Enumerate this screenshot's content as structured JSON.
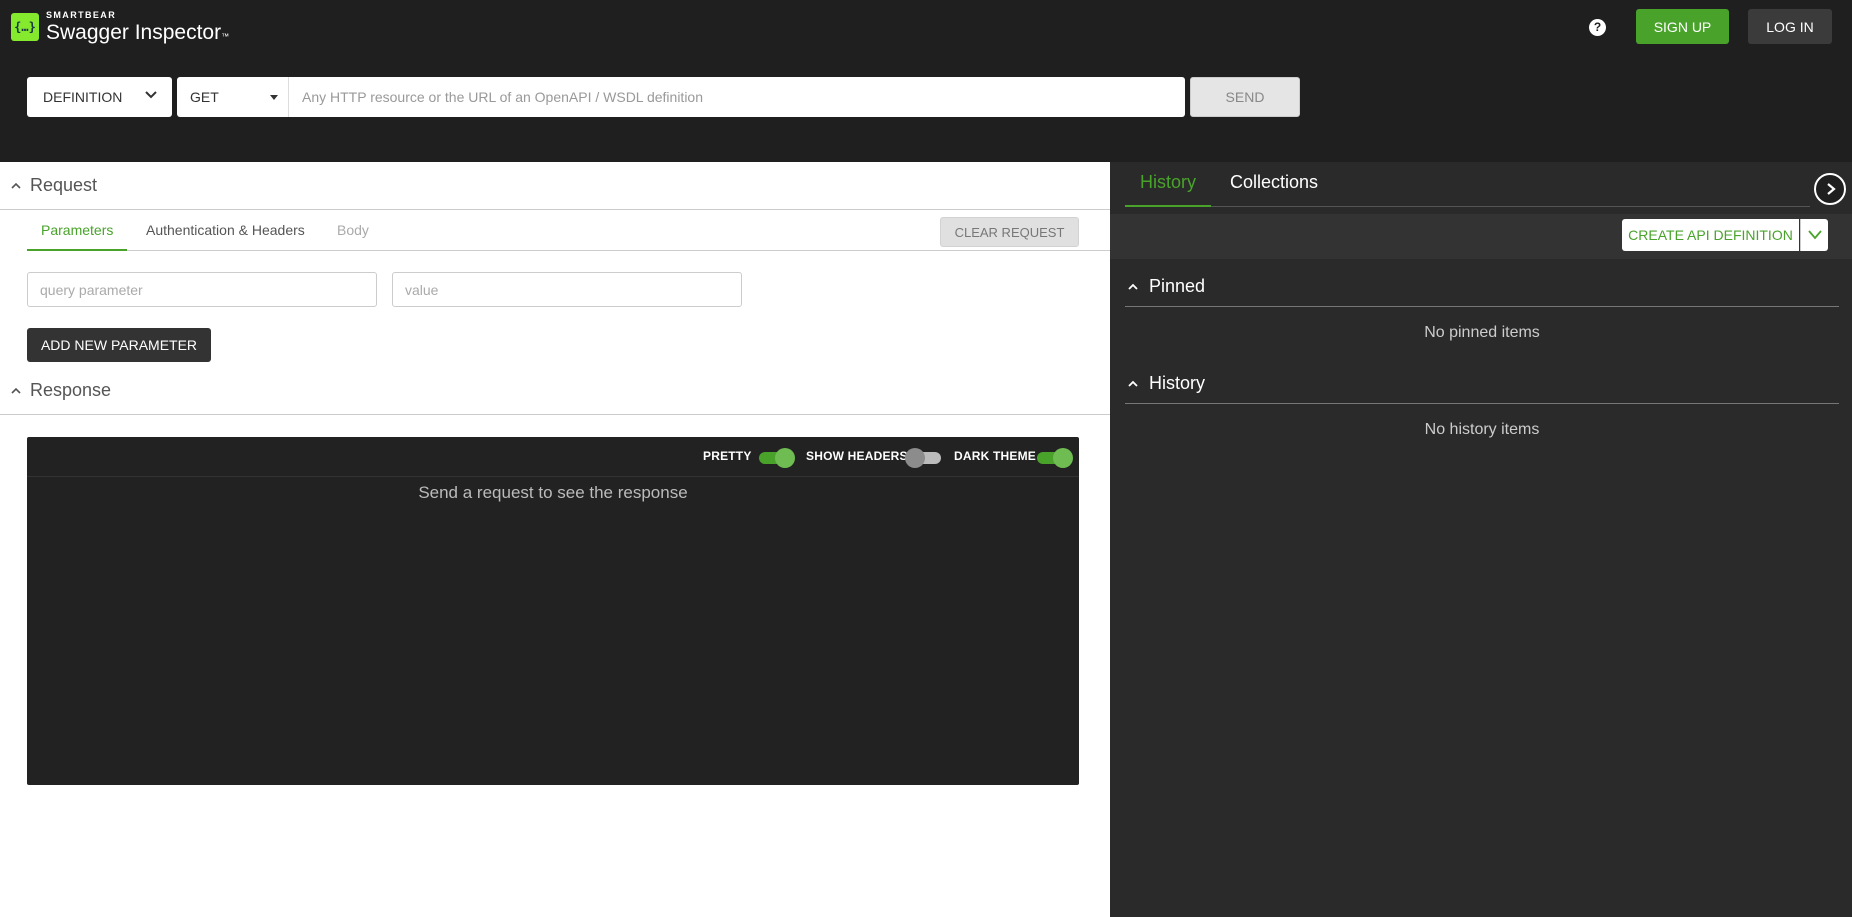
{
  "header": {
    "logo_brand": "SMARTBEAR",
    "logo_product": "Swagger Inspector",
    "logo_tm": "™",
    "help_icon": "?",
    "signup_label": "SIGN UP",
    "login_label": "LOG IN"
  },
  "request_bar": {
    "mode": "DEFINITION",
    "method": "GET",
    "url_placeholder": "Any HTTP resource or the URL of an OpenAPI / WSDL definition",
    "url_value": "",
    "send_label": "SEND"
  },
  "request": {
    "title": "Request",
    "tabs": [
      {
        "label": "Parameters",
        "state": "active"
      },
      {
        "label": "Authentication & Headers",
        "state": "normal"
      },
      {
        "label": "Body",
        "state": "disabled"
      }
    ],
    "clear_label": "CLEAR REQUEST",
    "param_key_placeholder": "query parameter",
    "param_value_placeholder": "value",
    "add_param_label": "ADD NEW PARAMETER"
  },
  "response": {
    "title": "Response",
    "toggles": [
      {
        "label": "PRETTY",
        "on": true
      },
      {
        "label": "SHOW HEADERS",
        "on": false
      },
      {
        "label": "DARK THEME",
        "on": true
      }
    ],
    "empty_message": "Send a request to see the response"
  },
  "sidebar": {
    "tabs": [
      {
        "label": "History",
        "state": "active"
      },
      {
        "label": "Collections",
        "state": "normal"
      }
    ],
    "create_label": "CREATE API DEFINITION",
    "pinned": {
      "title": "Pinned",
      "empty": "No pinned items"
    },
    "history": {
      "title": "History",
      "empty": "No history items"
    }
  },
  "colors": {
    "accent_green": "#49a32b",
    "logo_green": "#85ea2d",
    "dark_bg": "#1f1f1f",
    "panel_bg": "#2a2a2a"
  }
}
